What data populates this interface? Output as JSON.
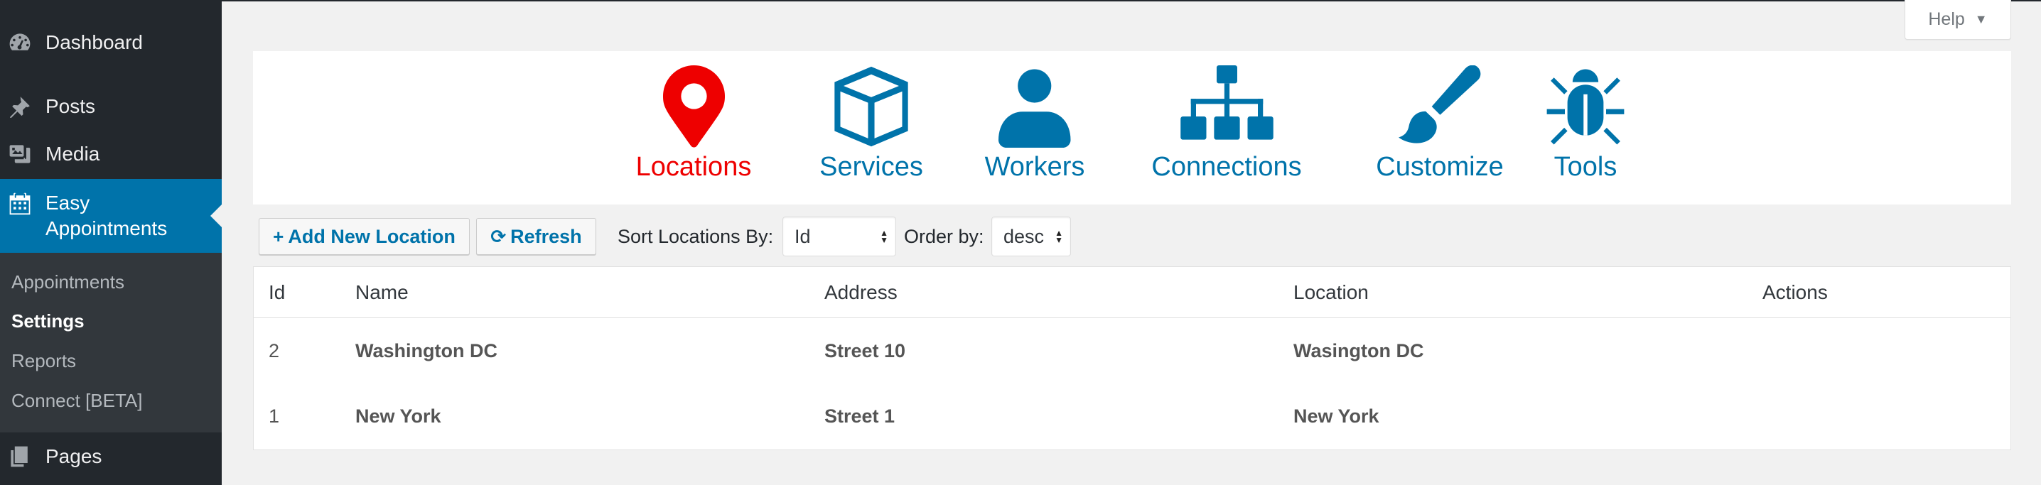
{
  "sidebar": {
    "items": [
      {
        "label": "Dashboard",
        "icon": "dashboard-icon"
      },
      {
        "label": "Posts",
        "icon": "pushpin-icon"
      },
      {
        "label": "Media",
        "icon": "media-icon"
      },
      {
        "label": "Easy Appointments",
        "icon": "calendar-icon"
      },
      {
        "label": "Pages",
        "icon": "pages-icon"
      }
    ],
    "submenu": [
      "Appointments",
      "Settings",
      "Reports",
      "Connect [BETA]"
    ],
    "current_submenu": "Settings"
  },
  "help": {
    "label": "Help",
    "caret": "▼"
  },
  "tabs": [
    {
      "label": "Locations",
      "icon": "map-pin-icon",
      "active": true
    },
    {
      "label": "Services",
      "icon": "box-icon",
      "active": false
    },
    {
      "label": "Workers",
      "icon": "user-icon",
      "active": false
    },
    {
      "label": "Connections",
      "icon": "sitemap-icon",
      "active": false
    },
    {
      "label": "Customize",
      "icon": "paintbrush-icon",
      "active": false
    },
    {
      "label": "Tools",
      "icon": "bug-icon",
      "active": false
    }
  ],
  "toolbar": {
    "add_label": "Add New Location",
    "add_icon": "+",
    "refresh_label": "Refresh",
    "refresh_icon": "⟳",
    "sort_label": "Sort Locations By:",
    "sort_value": "Id",
    "order_label": "Order by:",
    "order_value": "desc"
  },
  "table": {
    "headers": [
      "Id",
      "Name",
      "Address",
      "Location",
      "Actions"
    ],
    "rows": [
      {
        "id": "2",
        "name": "Washington DC",
        "address": "Street 10",
        "location": "Wasington DC"
      },
      {
        "id": "1",
        "name": "New York",
        "address": "Street 1",
        "location": "New York"
      }
    ]
  },
  "colors": {
    "sidebar_bg": "#23282d",
    "submenu_bg": "#32373c",
    "accent": "#0073aa",
    "active_tab": "#ee0000",
    "page_bg": "#f1f1f1"
  }
}
